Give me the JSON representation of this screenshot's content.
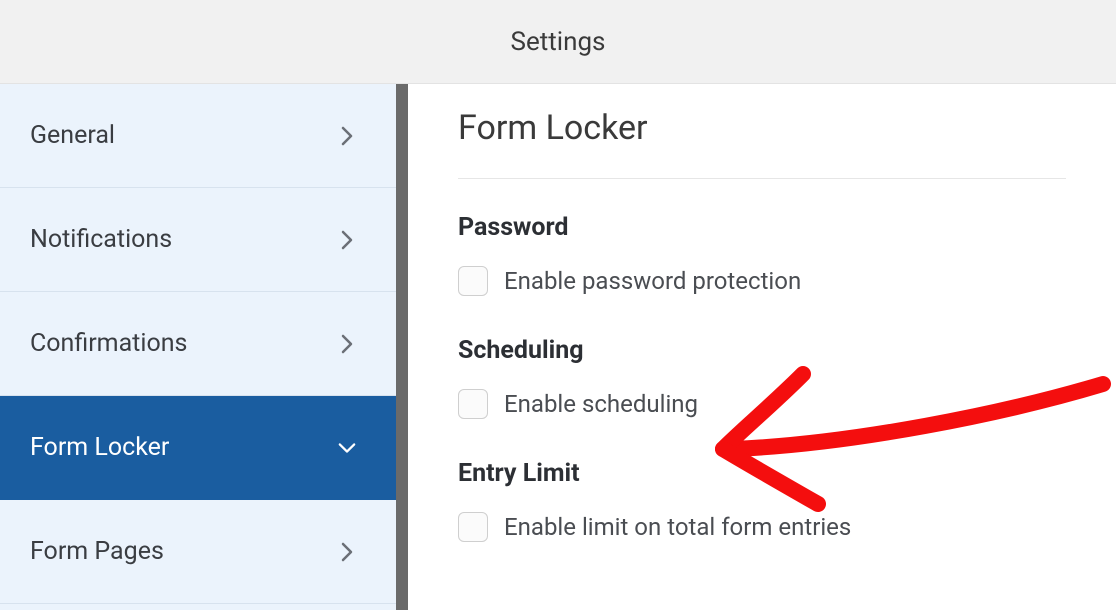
{
  "header": {
    "title": "Settings"
  },
  "sidebar": {
    "items": [
      {
        "label": "General",
        "expanded": false,
        "active": false
      },
      {
        "label": "Notifications",
        "expanded": false,
        "active": false
      },
      {
        "label": "Confirmations",
        "expanded": false,
        "active": false
      },
      {
        "label": "Form Locker",
        "expanded": true,
        "active": true
      },
      {
        "label": "Form Pages",
        "expanded": false,
        "active": false
      }
    ]
  },
  "main": {
    "title": "Form Locker",
    "sections": [
      {
        "heading": "Password",
        "checkbox_label": "Enable password protection",
        "checked": false
      },
      {
        "heading": "Scheduling",
        "checkbox_label": "Enable scheduling",
        "checked": false
      },
      {
        "heading": "Entry Limit",
        "checkbox_label": "Enable limit on total form entries",
        "checked": false
      }
    ]
  }
}
